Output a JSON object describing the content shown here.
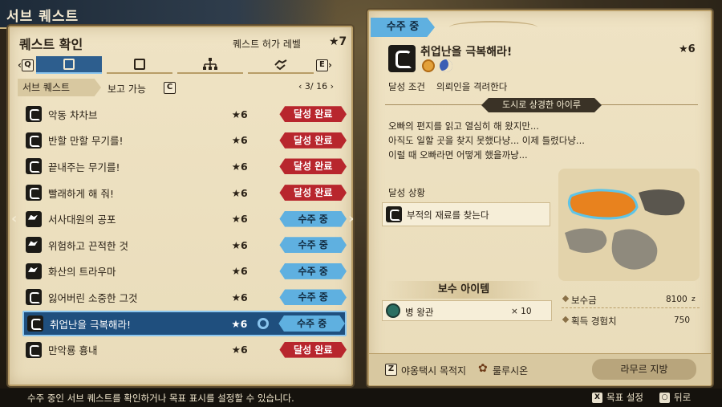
{
  "header": {
    "title": "서브 퀘스트"
  },
  "left": {
    "title": "퀘스트 확인",
    "level_label": "퀘스트 허가 레벨",
    "level_value": "★7",
    "tab_left_key": "Q",
    "tab_right_key": "E",
    "filter_sub": "서브 퀘스트",
    "filter_report": "보고 가능",
    "filter_key": "C",
    "page": "3/ 16"
  },
  "quests": [
    {
      "name": "악동 차차브",
      "stars": "★6",
      "status": "달성 완료",
      "icon": "cat-icon"
    },
    {
      "name": "반할 만할 무기를!",
      "stars": "★6",
      "status": "달성 완료",
      "icon": "cat-icon"
    },
    {
      "name": "끝내주는 무기를!",
      "stars": "★6",
      "status": "달성 완료",
      "icon": "cat-icon"
    },
    {
      "name": "빨래하게 해 줘!",
      "stars": "★6",
      "status": "달성 완료",
      "icon": "cat-icon"
    },
    {
      "name": "서사대원의 공포",
      "stars": "★6",
      "status": "수주 중",
      "icon": "monster-icon"
    },
    {
      "name": "위험하고 끈적한 것",
      "stars": "★6",
      "status": "수주 중",
      "icon": "monster-icon"
    },
    {
      "name": "화산의 트라우마",
      "stars": "★6",
      "status": "수주 중",
      "icon": "monster-icon"
    },
    {
      "name": "잃어버린 소중한 그것",
      "stars": "★6",
      "status": "수주 중",
      "icon": "cat-icon"
    },
    {
      "name": "취업난을 극복해라!",
      "stars": "★6",
      "status": "수주 중",
      "icon": "cat-icon",
      "selected": true
    },
    {
      "name": "만악룡 흉내",
      "stars": "★6",
      "status": "달성 완료",
      "icon": "cat-icon"
    }
  ],
  "detail": {
    "badge": "수주 중",
    "title": "취업난을 극복해라!",
    "stars": "★6",
    "condition_label": "달성 조건",
    "condition_value": "의뢰인을 격려한다",
    "client": "도시로 상경한 아이루",
    "desc1": "오빠의 편지를 읽고 열심히 해 왔지만...",
    "desc2": "아직도 일할 곳을 찾지 못했다냥... 이제 틀렸다냥...",
    "desc3": "이럴 때 오빠라면 어떻게 했을까냥...",
    "progress_label": "달성 상황",
    "progress_text": "부적의 재료를 찾는다",
    "reward_header": "보수 아이템",
    "reward_item": "병 왕관",
    "reward_qty": "× 10",
    "money_label": "보수금",
    "money_value": "8100",
    "money_unit": "z",
    "xp_label": "획득 경험치",
    "xp_value": "750",
    "footer_key": "Z",
    "footer_taxi": "야옹택시 목적지",
    "footer_location": "룰루시온",
    "footer_region": "라무르 지방"
  },
  "bottom": {
    "help": "수주 중인 서브 퀘스트를 확인하거나 목표 표시를 설정할 수 있습니다.",
    "btn1_key": "X",
    "btn1_label": "목표 설정",
    "btn2_key": "○",
    "btn2_label": "뒤로"
  },
  "colors": {
    "done": "#b8262d",
    "active": "#5fb0e0",
    "selected": "#1f4f7e",
    "parchment": "#efe3c4"
  }
}
